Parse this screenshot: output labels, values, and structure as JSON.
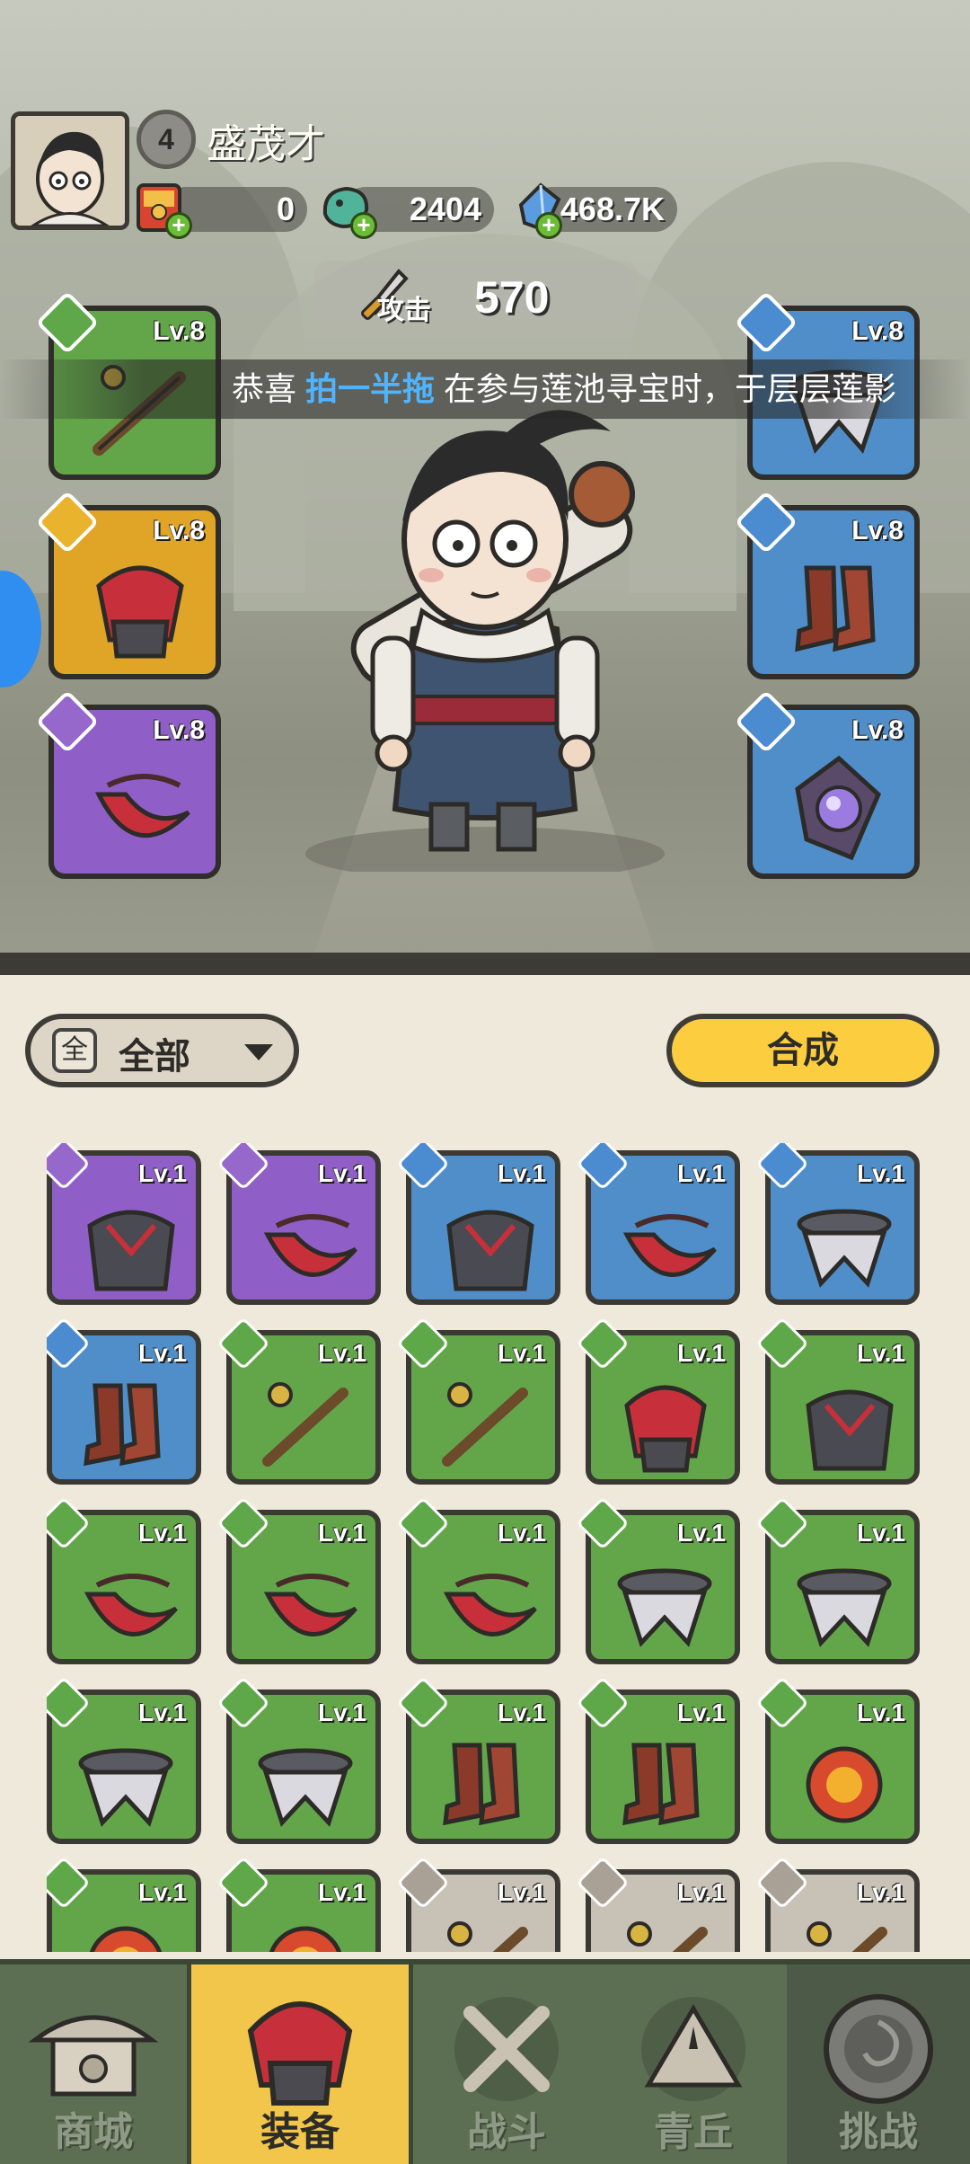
{
  "player": {
    "level": "4",
    "name": "盛茂才"
  },
  "resources": [
    {
      "icon": "red-envelope-icon",
      "value": "0"
    },
    {
      "icon": "jade-dragon-icon",
      "value": "2404"
    },
    {
      "icon": "blue-crystal-icon",
      "value": "468.7K"
    }
  ],
  "attack": {
    "label": "攻击",
    "value": "570"
  },
  "news": {
    "prefix": "恭喜 ",
    "highlight": "拍一半拖",
    "suffix": " 在参与莲池寻宝时，于层层莲影"
  },
  "equipped": {
    "left": [
      {
        "level": "Lv.8",
        "rarity": "green",
        "icon": "weapon-icon"
      },
      {
        "level": "Lv.8",
        "rarity": "yellow",
        "icon": "helmet-icon"
      },
      {
        "level": "Lv.8",
        "rarity": "purple",
        "icon": "amulet-icon"
      }
    ],
    "right": [
      {
        "level": "Lv.8",
        "rarity": "blue",
        "icon": "belt-icon"
      },
      {
        "level": "Lv.8",
        "rarity": "blue",
        "icon": "boots-icon"
      },
      {
        "level": "Lv.8",
        "rarity": "blue",
        "icon": "orb-icon"
      }
    ]
  },
  "filter": {
    "icon_text": "全",
    "label": "全部"
  },
  "combine_button": "合成",
  "inventory": [
    {
      "level": "Lv.1",
      "rarity": "purple",
      "icon": "armor-icon"
    },
    {
      "level": "Lv.1",
      "rarity": "purple",
      "icon": "amulet-icon"
    },
    {
      "level": "Lv.1",
      "rarity": "blue",
      "icon": "armor-icon"
    },
    {
      "level": "Lv.1",
      "rarity": "blue",
      "icon": "amulet-icon"
    },
    {
      "level": "Lv.1",
      "rarity": "blue",
      "icon": "belt-icon"
    },
    {
      "level": "Lv.1",
      "rarity": "blue",
      "icon": "boots-icon"
    },
    {
      "level": "Lv.1",
      "rarity": "green",
      "icon": "weapon-icon"
    },
    {
      "level": "Lv.1",
      "rarity": "green",
      "icon": "weapon-icon"
    },
    {
      "level": "Lv.1",
      "rarity": "green",
      "icon": "helmet-icon"
    },
    {
      "level": "Lv.1",
      "rarity": "green",
      "icon": "armor-icon"
    },
    {
      "level": "Lv.1",
      "rarity": "green",
      "icon": "amulet-icon"
    },
    {
      "level": "Lv.1",
      "rarity": "green",
      "icon": "amulet-icon"
    },
    {
      "level": "Lv.1",
      "rarity": "green",
      "icon": "amulet-icon"
    },
    {
      "level": "Lv.1",
      "rarity": "green",
      "icon": "belt-icon"
    },
    {
      "level": "Lv.1",
      "rarity": "green",
      "icon": "belt-icon"
    },
    {
      "level": "Lv.1",
      "rarity": "green",
      "icon": "belt-icon"
    },
    {
      "level": "Lv.1",
      "rarity": "green",
      "icon": "belt-icon"
    },
    {
      "level": "Lv.1",
      "rarity": "green",
      "icon": "boots-icon"
    },
    {
      "level": "Lv.1",
      "rarity": "green",
      "icon": "boots-icon"
    },
    {
      "level": "Lv.1",
      "rarity": "green",
      "icon": "orb-icon"
    },
    {
      "level": "Lv.1",
      "rarity": "green",
      "icon": "orb-icon"
    },
    {
      "level": "Lv.1",
      "rarity": "green",
      "icon": "orb-icon"
    },
    {
      "level": "Lv.1",
      "rarity": "grey",
      "icon": "weapon-icon"
    },
    {
      "level": "Lv.1",
      "rarity": "grey",
      "icon": "weapon-icon"
    },
    {
      "level": "Lv.1",
      "rarity": "grey",
      "icon": "weapon-icon"
    }
  ],
  "nav": [
    {
      "label": "商城",
      "icon": "shop-pavilion-icon",
      "active": false
    },
    {
      "label": "装备",
      "icon": "helmet-icon",
      "active": true
    },
    {
      "label": "战斗",
      "icon": "crossed-swords-icon",
      "active": false
    },
    {
      "label": "青丘",
      "icon": "mountain-icon",
      "active": false
    },
    {
      "label": "挑战",
      "icon": "vortex-icon",
      "active": false
    }
  ],
  "colors": {
    "green": "#63a64a",
    "yellow": "#e0a526",
    "purple": "#8f5fc7",
    "blue": "#4f8ec8",
    "grey": "#c8c2b6",
    "accent_button": "#fbcd3f",
    "news_highlight": "#4fb4ff"
  }
}
